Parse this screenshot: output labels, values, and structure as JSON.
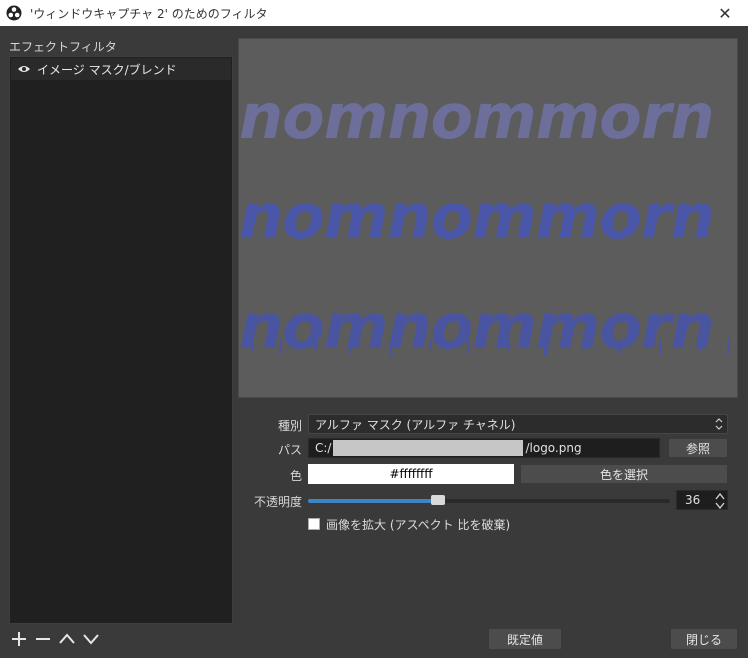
{
  "window": {
    "title": "'ウィンドウキャプチャ 2' のためのフィルタ",
    "close_glyph": "✕"
  },
  "filters": {
    "label": "エフェクトフィルタ",
    "items": [
      {
        "label": "イメージ マスク/ブレンド",
        "visible": true
      }
    ]
  },
  "preview": {
    "rows": [
      "nomnommorn",
      "nomnommorn",
      "nomnommorn"
    ]
  },
  "properties": {
    "type": {
      "label": "種別",
      "value": "アルファ マスク (アルファ チャネル)"
    },
    "path": {
      "label": "パス",
      "prefix": "C:/",
      "suffix": "/logo.png",
      "browse_label": "参照"
    },
    "color": {
      "label": "色",
      "value": "#ffffffff",
      "select_label": "色を選択"
    },
    "opacity": {
      "label": "不透明度",
      "value": "36",
      "fraction": 0.36
    },
    "stretch": {
      "label": "画像を拡大 (アスペクト 比を破棄)",
      "checked": false
    }
  },
  "footer": {
    "defaults_label": "既定値",
    "close_label": "閉じる"
  },
  "colors": {
    "accent": "#3d86c6"
  }
}
